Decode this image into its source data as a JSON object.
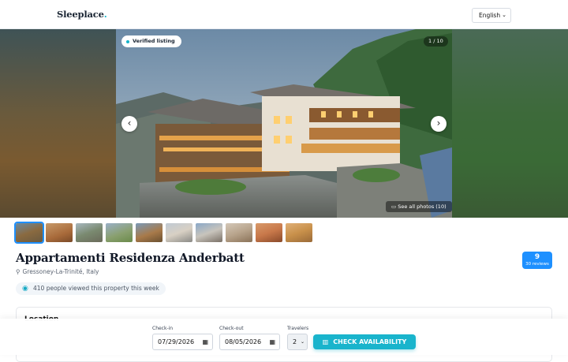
{
  "header": {
    "logo": "Sleeplace",
    "logo_dot": ".",
    "language": "English"
  },
  "gallery": {
    "verified_badge": "Verified listing",
    "counter": "1 / 10",
    "see_all": "See all photos (10)"
  },
  "listing": {
    "title": "Appartamenti Residenza Anderbatt",
    "location": "Gressoney-La-Trinité, Italy",
    "rating": "9",
    "reviews": "30 reviews",
    "viewed_note": "410 people viewed this property this week"
  },
  "location_section": {
    "heading": "Location"
  },
  "booking": {
    "checkin_label": "Check-in",
    "checkin_value": "07/29/2026",
    "checkout_label": "Check-out",
    "checkout_value": "08/05/2026",
    "travelers_label": "Travelers",
    "travelers_value": "2",
    "cta": "CHECK AVAILABILITY"
  },
  "colors": {
    "accent": "#19b4cc",
    "rating_badge": "#1e90ff"
  },
  "icons": [
    "chevron-down-icon",
    "chevron-left-icon",
    "chevron-right-icon",
    "gallery-icon",
    "map-pin-icon",
    "eye-icon",
    "calendar-icon",
    "building-icon"
  ]
}
